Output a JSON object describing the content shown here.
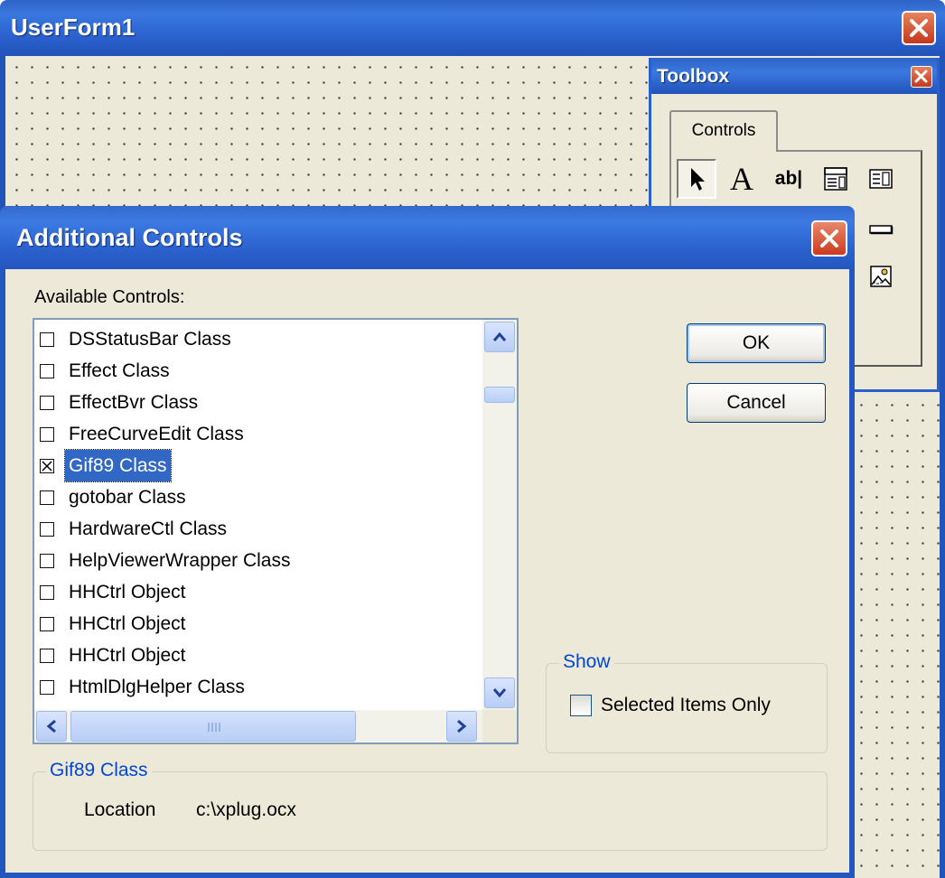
{
  "userform": {
    "title": "UserForm1"
  },
  "toolbox": {
    "title": "Toolbox",
    "tab": "Controls",
    "tools": [
      {
        "icon": "select-pointer-icon"
      },
      {
        "icon": "label-icon",
        "glyph": "A"
      },
      {
        "icon": "textbox-icon",
        "glyph": "ab|"
      },
      {
        "icon": "combobox-icon"
      },
      {
        "icon": "listbox-icon"
      },
      {
        "icon": "command-button-icon"
      },
      {
        "icon": "image-icon"
      }
    ]
  },
  "dialog": {
    "title": "Additional Controls",
    "available_label": "Available Controls:",
    "items": [
      {
        "label": "DSStatusBar Class",
        "checked": false
      },
      {
        "label": "Effect Class",
        "checked": false
      },
      {
        "label": "EffectBvr Class",
        "checked": false
      },
      {
        "label": "FreeCurveEdit Class",
        "checked": false
      },
      {
        "label": "Gif89 Class",
        "checked": true,
        "selected": true
      },
      {
        "label": "gotobar Class",
        "checked": false
      },
      {
        "label": "HardwareCtl Class",
        "checked": false
      },
      {
        "label": "HelpViewerWrapper Class",
        "checked": false
      },
      {
        "label": "HHCtrl Object",
        "checked": false
      },
      {
        "label": "HHCtrl Object",
        "checked": false
      },
      {
        "label": "HHCtrl Object",
        "checked": false
      },
      {
        "label": "HtmlDlgHelper Class",
        "checked": false
      }
    ],
    "ok_label": "OK",
    "cancel_label": "Cancel",
    "show_group": {
      "legend": "Show",
      "option_label": "Selected Items Only",
      "checked": false
    },
    "info_group": {
      "legend": "Gif89 Class",
      "location_label": "Location",
      "location_value": "c:\\xplug.ocx"
    },
    "colors": {
      "accent": "#3168c6",
      "title_bar": "#2356bf",
      "face": "#ece9d8",
      "group_legend": "#0046d5"
    }
  }
}
